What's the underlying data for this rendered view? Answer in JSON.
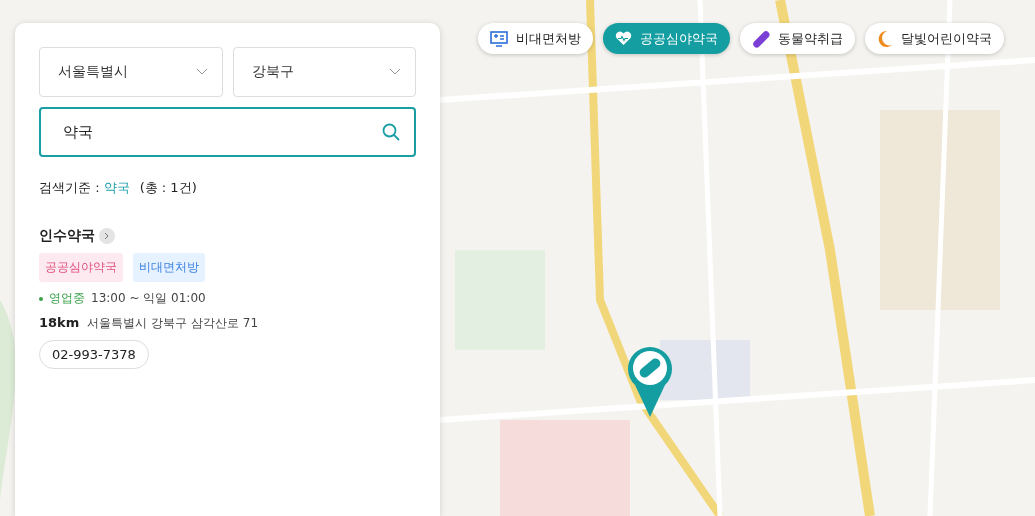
{
  "filters": [
    {
      "label": "비대면처방",
      "kind": "telemedicine",
      "selected": false
    },
    {
      "label": "공공심야약국",
      "kind": "night",
      "selected": true
    },
    {
      "label": "동물약취급",
      "kind": "pet",
      "selected": false
    },
    {
      "label": "달빛어린이약국",
      "kind": "moon",
      "selected": false
    }
  ],
  "region": {
    "city": "서울특별시",
    "district": "강북구"
  },
  "search": {
    "value": "약국"
  },
  "criteria": {
    "label": "검색기준 :",
    "keyword": "약국",
    "total": "(총 : 1건)"
  },
  "results": [
    {
      "name": "인수약국",
      "tags": [
        {
          "label": "공공심야약국",
          "kind": "night"
        },
        {
          "label": "비대면처방",
          "kind": "telemedicine"
        }
      ],
      "status": "영업중",
      "open": true,
      "hours": "13:00 ~ 익일 01:00",
      "distance": "18km",
      "address": "서울특별시 강북구 삼각산로 71",
      "phone": "02-993-7378"
    }
  ]
}
